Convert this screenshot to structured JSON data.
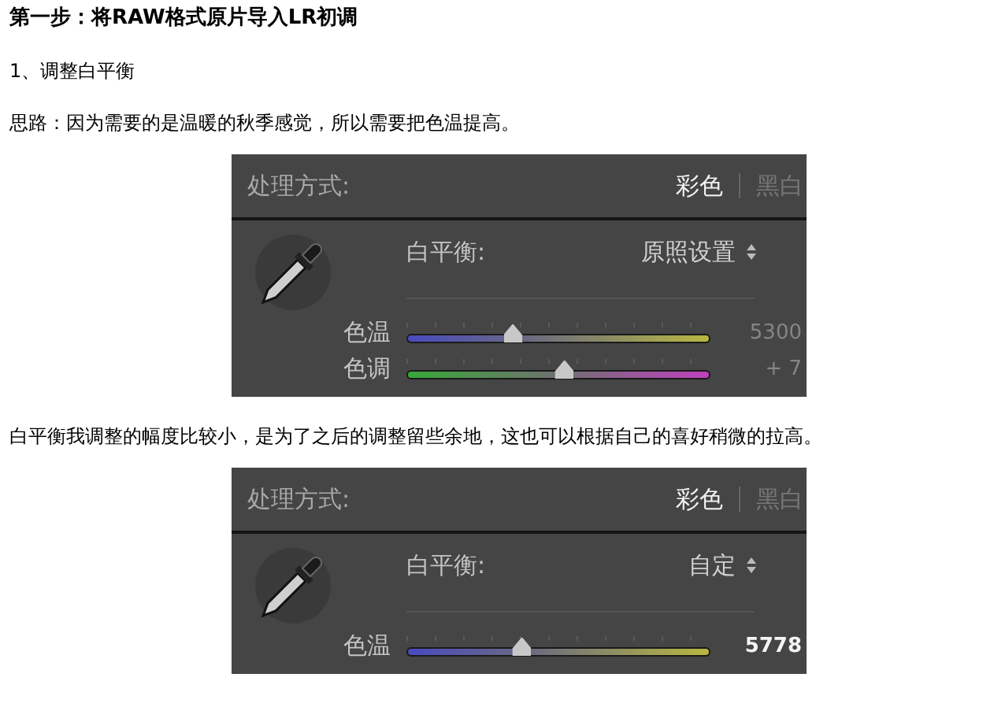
{
  "content": [
    {
      "kind": "heading",
      "text": "第一步：将RAW格式原片导入LR初调"
    },
    {
      "kind": "text",
      "text": "1、调整白平衡"
    },
    {
      "kind": "text",
      "text": "思路：因为需要的是温暖的秋季感觉，所以需要把色温提高。"
    },
    {
      "kind": "panel",
      "label": "处理方式:",
      "modes": [
        {
          "label": "彩色",
          "selected": true
        },
        {
          "label": "黑白",
          "selected": false
        }
      ],
      "wb_label": "白平衡:",
      "wb_value": "原照设置",
      "sliders": [
        {
          "kind": "temperature",
          "label": "色温",
          "level": 0.35,
          "reading": "5300",
          "highlighted": false
        },
        {
          "kind": "tint",
          "label": "色调",
          "level": 0.52,
          "reading": "+ 7",
          "highlighted": false
        }
      ]
    },
    {
      "kind": "text",
      "text": "白平衡我调整的幅度比较小，是为了之后的调整留些余地，这也可以根据自己的喜好稍微的拉高。"
    },
    {
      "kind": "panel",
      "label": "处理方式:",
      "modes": [
        {
          "label": "彩色",
          "selected": true
        },
        {
          "label": "黑白",
          "selected": false
        }
      ],
      "wb_label": "白平衡:",
      "wb_value": "自定",
      "sliders": [
        {
          "kind": "temperature",
          "label": "色温",
          "level": 0.38,
          "reading": "5778",
          "highlighted": true
        }
      ]
    }
  ]
}
